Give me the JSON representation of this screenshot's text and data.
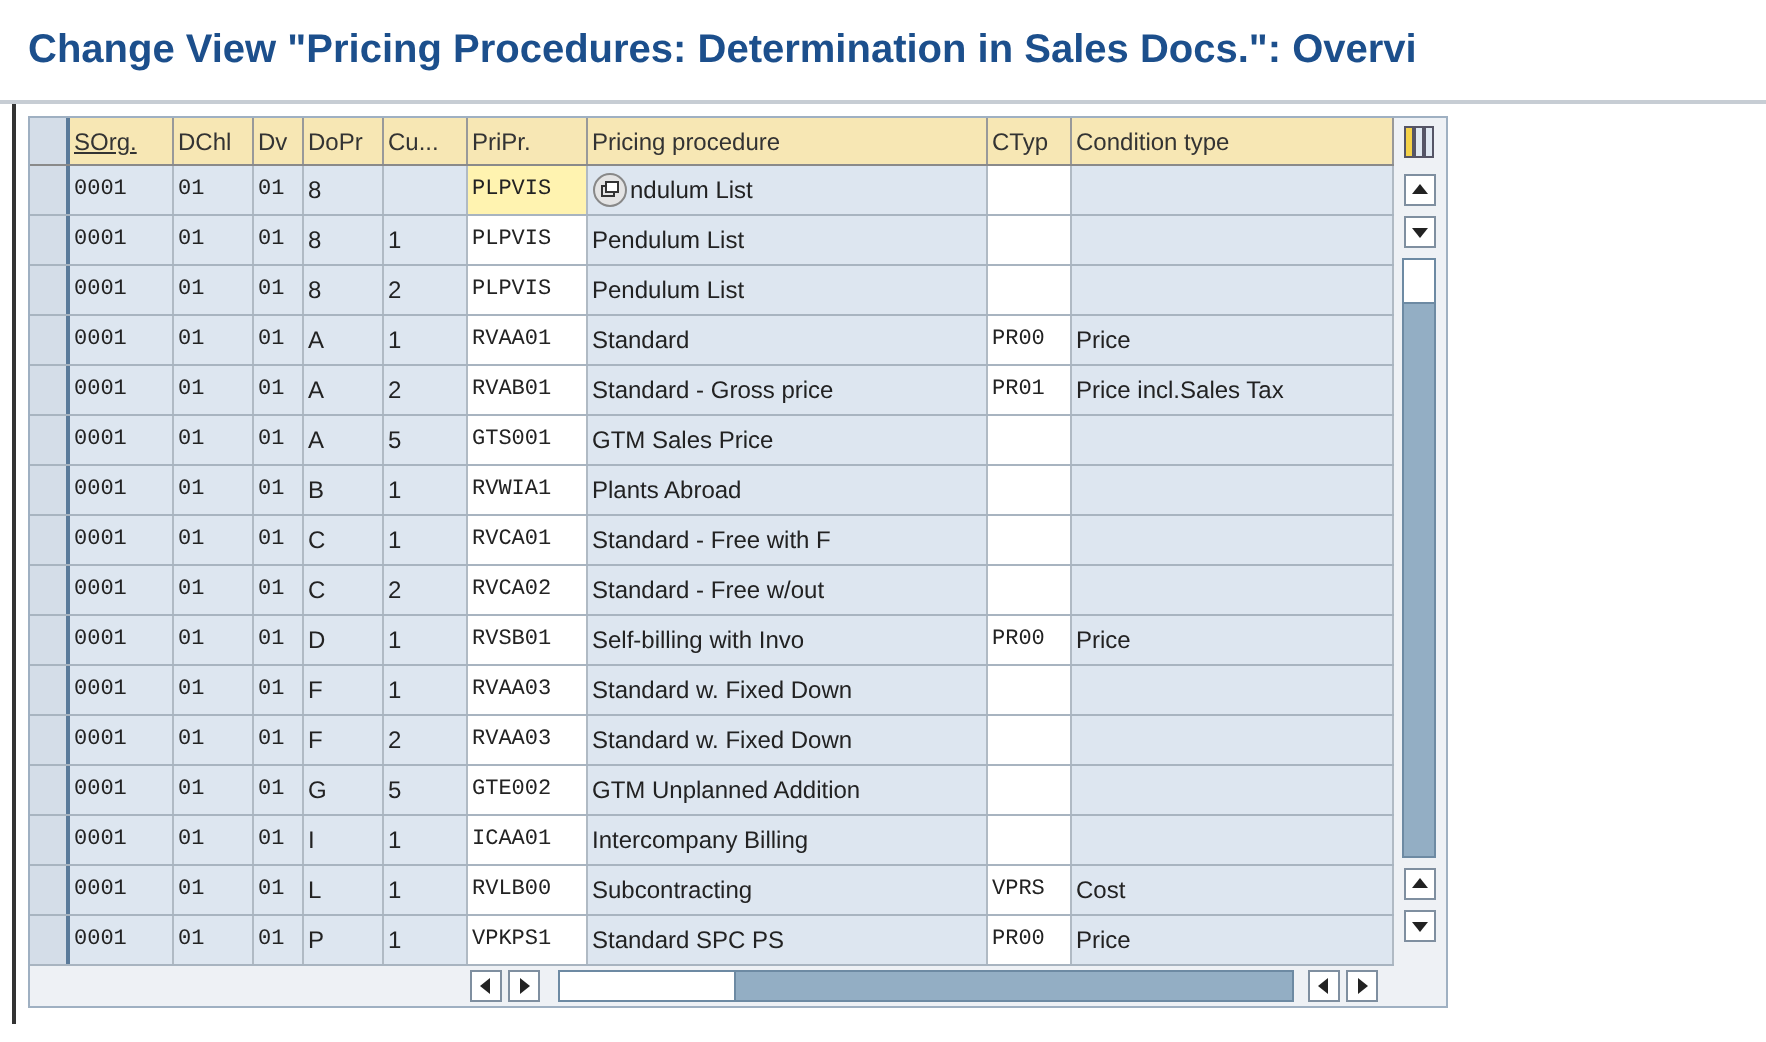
{
  "window": {
    "title": "Change View \"Pricing Procedures: Determination in Sales Docs.\": Overvi"
  },
  "table": {
    "columns": [
      "SOrg.",
      "DChl",
      "Dv",
      "DoPr",
      "Cu...",
      "PriPr.",
      "Pricing procedure",
      "CTyp",
      "Condition type"
    ],
    "rows": [
      {
        "cells": [
          "0001",
          "01",
          "01",
          "8",
          "",
          "PLPVIS",
          "ndulum List",
          "",
          ""
        ],
        "focused": true,
        "cursor": true
      },
      {
        "cells": [
          "0001",
          "01",
          "01",
          "8",
          "1",
          "PLPVIS",
          "Pendulum List",
          "",
          ""
        ],
        "focused": false,
        "cursor": false
      },
      {
        "cells": [
          "0001",
          "01",
          "01",
          "8",
          "2",
          "PLPVIS",
          "Pendulum List",
          "",
          ""
        ],
        "focused": false,
        "cursor": false
      },
      {
        "cells": [
          "0001",
          "01",
          "01",
          "A",
          "1",
          "RVAA01",
          "Standard",
          "PR00",
          "Price"
        ],
        "focused": false,
        "cursor": false
      },
      {
        "cells": [
          "0001",
          "01",
          "01",
          "A",
          "2",
          "RVAB01",
          "Standard - Gross price",
          "PR01",
          "Price incl.Sales Tax"
        ],
        "focused": false,
        "cursor": false
      },
      {
        "cells": [
          "0001",
          "01",
          "01",
          "A",
          "5",
          "GTS001",
          "GTM Sales Price",
          "",
          ""
        ],
        "focused": false,
        "cursor": false
      },
      {
        "cells": [
          "0001",
          "01",
          "01",
          "B",
          "1",
          "RVWIA1",
          "Plants Abroad",
          "",
          ""
        ],
        "focused": false,
        "cursor": false
      },
      {
        "cells": [
          "0001",
          "01",
          "01",
          "C",
          "1",
          "RVCA01",
          "Standard - Free with F",
          "",
          ""
        ],
        "focused": false,
        "cursor": false
      },
      {
        "cells": [
          "0001",
          "01",
          "01",
          "C",
          "2",
          "RVCA02",
          "Standard - Free w/out",
          "",
          ""
        ],
        "focused": false,
        "cursor": false
      },
      {
        "cells": [
          "0001",
          "01",
          "01",
          "D",
          "1",
          "RVSB01",
          "Self-billing with Invo",
          "PR00",
          "Price"
        ],
        "focused": false,
        "cursor": false
      },
      {
        "cells": [
          "0001",
          "01",
          "01",
          "F",
          "1",
          "RVAA03",
          "Standard w. Fixed Down",
          "",
          ""
        ],
        "focused": false,
        "cursor": false
      },
      {
        "cells": [
          "0001",
          "01",
          "01",
          "F",
          "2",
          "RVAA03",
          "Standard w. Fixed Down",
          "",
          ""
        ],
        "focused": false,
        "cursor": false
      },
      {
        "cells": [
          "0001",
          "01",
          "01",
          "G",
          "5",
          "GTE002",
          "GTM Unplanned Addition",
          "",
          ""
        ],
        "focused": false,
        "cursor": false
      },
      {
        "cells": [
          "0001",
          "01",
          "01",
          "I",
          "1",
          "ICAA01",
          "Intercompany Billing",
          "",
          ""
        ],
        "focused": false,
        "cursor": false
      },
      {
        "cells": [
          "0001",
          "01",
          "01",
          "L",
          "1",
          "RVLB00",
          "Subcontracting",
          "VPRS",
          "Cost"
        ],
        "focused": false,
        "cursor": false
      },
      {
        "cells": [
          "0001",
          "01",
          "01",
          "P",
          "1",
          "VPKPS1",
          "Standard SPC PS",
          "PR00",
          "Price"
        ],
        "focused": false,
        "cursor": false
      }
    ]
  }
}
